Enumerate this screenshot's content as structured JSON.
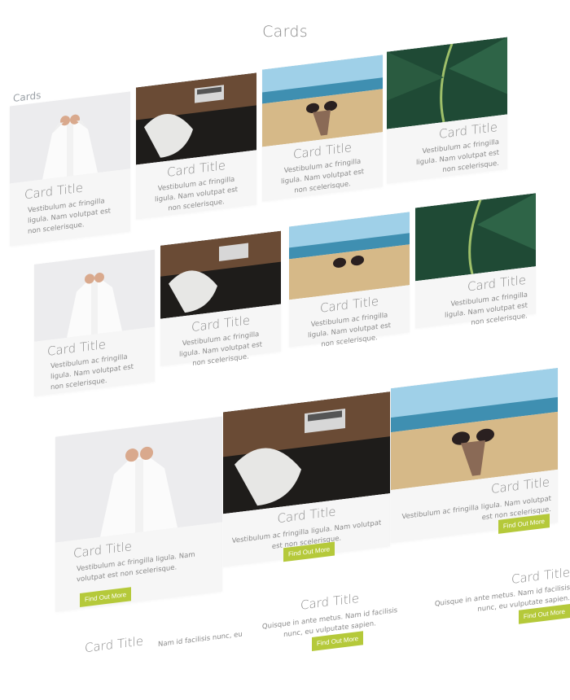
{
  "header": {
    "title": "Cards"
  },
  "section_label": "Cards",
  "card_title": "Card Title",
  "card_text": "Vestibulum ac fringilla ligula. Nam volutpat est non scelerisque.",
  "button_label": "Find Out More",
  "alt_text": "Quisque in ante metus. Nam id facilisis nunc, eu vulputate sapien.",
  "alt_text_short": "Nam id facilisis nunc, eu",
  "images": [
    "shirt-photo",
    "desk-laptop-photo",
    "sunglasses-beach-photo",
    "leaf-photo"
  ],
  "colors": {
    "button": "#b5c93a",
    "card_bg": "#f6f6f6",
    "text": "#8a8a8a"
  }
}
